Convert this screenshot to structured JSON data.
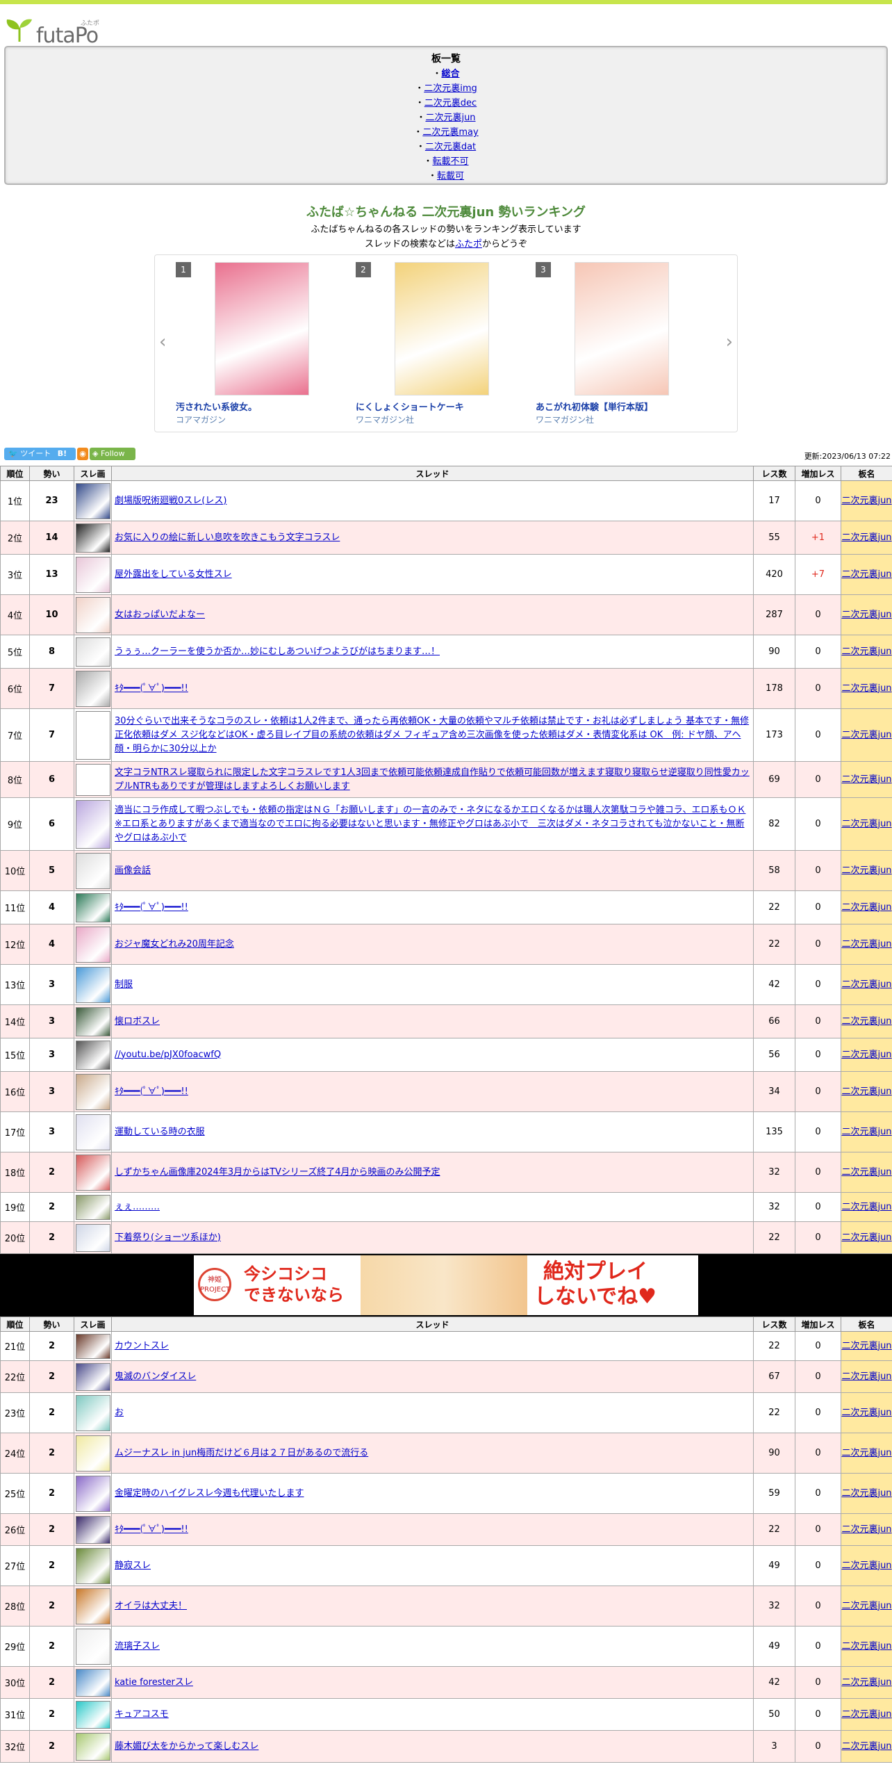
{
  "site": {
    "logo_text": "futaPo",
    "logo_kana": "ふたポ"
  },
  "boards": {
    "title": "板一覧",
    "items": [
      {
        "label": "総合",
        "bold": true
      },
      {
        "label": "二次元裏img"
      },
      {
        "label": "二次元裏dec"
      },
      {
        "label": "二次元裏jun"
      },
      {
        "label": "二次元裏may"
      },
      {
        "label": "二次元裏dat"
      },
      {
        "label": "転載不可"
      },
      {
        "label": "転載可"
      }
    ]
  },
  "heading": {
    "title": "ふたば☆ちゃんねる 二次元裏jun 勢いランキング",
    "desc1": "ふたばちゃんねるの各スレッドの勢いをランキング表示しています",
    "desc2_pre": "スレッドの検索などは",
    "desc2_link": "ふたポ",
    "desc2_post": "からどうぞ"
  },
  "carousel": [
    {
      "num": "1",
      "title": "汚されたい系彼女。",
      "publisher": "コアマガジン",
      "color": "#e9708e"
    },
    {
      "num": "2",
      "title": "にくしょくショートケーキ",
      "publisher": "ワニマガジン社",
      "color": "#f3d27a"
    },
    {
      "num": "3",
      "title": "あこがれ初体験【単行本版】",
      "publisher": "ワニマガジン社",
      "color": "#f6c6b5"
    }
  ],
  "share": {
    "tweet": "ツイート",
    "follow": "Follow",
    "updated": "更新:2023/06/13 07:22"
  },
  "columns": {
    "pos": "順位",
    "momentum": "勢い",
    "thumb": "スレ画",
    "thread": "スレッド",
    "res": "レス数",
    "inc": "増加レス",
    "board": "板名"
  },
  "rows": [
    {
      "pos": "1位",
      "mom": "23",
      "title": "劇場版呪術廻戦0スレ(レス)",
      "res": "17",
      "inc": "0",
      "board": "二次元裏jun",
      "h": 58,
      "tc": "#334a8a"
    },
    {
      "pos": "2位",
      "mom": "14",
      "title": "お気に入りの絵に新しい息吹を吹きこもう文字コラスレ",
      "res": "55",
      "inc": "+1",
      "board": "二次元裏jun",
      "h": 48,
      "tc": "#222222"
    },
    {
      "pos": "3位",
      "mom": "13",
      "title": "屋外露出をしている女性スレ",
      "res": "420",
      "inc": "+7",
      "board": "二次元裏jun",
      "h": 58,
      "tc": "#e8c6d8"
    },
    {
      "pos": "4位",
      "mom": "10",
      "title": "女はおっぱいだよなー",
      "res": "287",
      "inc": "0",
      "board": "二次元裏jun",
      "h": 58,
      "tc": "#f1d2c8"
    },
    {
      "pos": "5位",
      "mom": "8",
      "title": "うぅぅ…クーラーを使うか否か…妙にむしあついげつようびがはちまります…！",
      "res": "90",
      "inc": "0",
      "board": "二次元裏jun",
      "h": 48,
      "tc": "#dddddd"
    },
    {
      "pos": "6位",
      "mom": "7",
      "title": "ｷﾀ━━━(ﾟ∀ﾟ)━━━!!",
      "res": "178",
      "inc": "0",
      "board": "二次元裏jun",
      "h": 58,
      "tc": "#aaaaaa"
    },
    {
      "pos": "7位",
      "mom": "7",
      "title": "30分ぐらいで出来そうなコラのスレ・依頼は1人2件まで、通ったら再依頼OK・大量の依頼やマルチ依頼は禁止です・お礼は必ずしましょう 基本です・無修正化依頼はダメ スジ化などはOK・虚ろ目レイプ目の系統の依頼はダメ フィギュア含め三次画像を使った依頼はダメ・表情変化系は OK　例: ドヤ顔、アヘ顔・明らかに30分以上か",
      "res": "173",
      "inc": "0",
      "board": "二次元裏jun",
      "h": 76,
      "tc": "#ffffff"
    },
    {
      "pos": "8位",
      "mom": "6",
      "title": "文字コラNTRスレ寝取られに限定した文字コラスレです1人3回まで依頼可能依頼達成自作貼りで依頼可能回数が増えます寝取り寝取らせ逆寝取り同性愛カップルNTRもありですが管理はしますよろしくお願いします",
      "res": "69",
      "inc": "0",
      "board": "二次元裏jun",
      "h": 52,
      "tc": "#ffffff"
    },
    {
      "pos": "9位",
      "mom": "6",
      "title": "適当にコラ作成して暇つぶしでも・依頼の指定はＮＧ「お願いします」の一言のみで・ネタになるかエロくなるかは職人次第駄コラや雑コラ、エロ系もＯＫ※エロ系とありますがあくまで適当なのでエロに拘る必要はないと思います・無修正やグロはあぶ小で　三次はダメ・ネタコラされても泣かないこと・無断やグロはあぶ小で",
      "res": "82",
      "inc": "0",
      "board": "二次元裏jun",
      "h": 76,
      "tc": "#b9a6de"
    },
    {
      "pos": "10位",
      "mom": "5",
      "title": "画像会話",
      "res": "58",
      "inc": "0",
      "board": "二次元裏jun",
      "h": 58,
      "tc": "#dddddd"
    },
    {
      "pos": "11位",
      "mom": "4",
      "title": "ｷﾀ━━━(ﾟ∀ﾟ)━━━!!",
      "res": "22",
      "inc": "0",
      "board": "二次元裏jun",
      "h": 48,
      "tc": "#2c7a58"
    },
    {
      "pos": "12位",
      "mom": "4",
      "title": "おジャ魔女どれみ20周年記念",
      "res": "22",
      "inc": "0",
      "board": "二次元裏jun",
      "h": 58,
      "tc": "#e9a8c6"
    },
    {
      "pos": "13位",
      "mom": "3",
      "title": "制服",
      "res": "42",
      "inc": "0",
      "board": "二次元裏jun",
      "h": 58,
      "tc": "#4a9ad8"
    },
    {
      "pos": "14位",
      "mom": "3",
      "title": "懐ロボスレ",
      "res": "66",
      "inc": "0",
      "board": "二次元裏jun",
      "h": 48,
      "tc": "#3a5a3a"
    },
    {
      "pos": "15位",
      "mom": "3",
      "title": "//youtu.be/pJX0foacwfQ",
      "res": "56",
      "inc": "0",
      "board": "二次元裏jun",
      "h": 48,
      "tc": "#555555"
    },
    {
      "pos": "16位",
      "mom": "3",
      "title": "ｷﾀ━━━(ﾟ∀ﾟ)━━━!!",
      "res": "34",
      "inc": "0",
      "board": "二次元裏jun",
      "h": 58,
      "tc": "#c9a98a"
    },
    {
      "pos": "17位",
      "mom": "3",
      "title": "運動している時の衣服",
      "res": "135",
      "inc": "0",
      "board": "二次元裏jun",
      "h": 58,
      "tc": "#e0e0f0"
    },
    {
      "pos": "18位",
      "mom": "2",
      "title": "しずかちゃん画像庫2024年3月からはTVシリーズ終了4月から映画のみ公開予定",
      "res": "32",
      "inc": "0",
      "board": "二次元裏jun",
      "h": 58,
      "tc": "#d65a5a"
    },
    {
      "pos": "19位",
      "mom": "2",
      "title": "ぇぇ………",
      "res": "32",
      "inc": "0",
      "board": "二次元裏jun",
      "h": 42,
      "tc": "#8a9a6a"
    },
    {
      "pos": "20位",
      "mom": "2",
      "title": "下着祭り(ショーツ系ほか)",
      "res": "22",
      "inc": "0",
      "board": "二次元裏jun",
      "h": 46,
      "tc": "#cfd6e6"
    }
  ],
  "ad": {
    "left": "今シコシコ\nできないなら",
    "right": "絶対プレイ\nしないでね♥",
    "badge": "神姫 PROJECT"
  },
  "rows2": [
    {
      "pos": "21位",
      "mom": "2",
      "title": "カウントスレ",
      "res": "22",
      "inc": "0",
      "board": "二次元裏jun",
      "h": 42,
      "tc": "#6a3a2a"
    },
    {
      "pos": "22位",
      "mom": "2",
      "title": "鬼滅のバンダイスレ",
      "res": "67",
      "inc": "0",
      "board": "二次元裏jun",
      "h": 46,
      "tc": "#4a4a8a"
    },
    {
      "pos": "23位",
      "mom": "2",
      "title": "お",
      "res": "22",
      "inc": "0",
      "board": "二次元裏jun",
      "h": 58,
      "tc": "#7ec8c0"
    },
    {
      "pos": "24位",
      "mom": "2",
      "title": "ムジーナスレ in jun梅雨だけど６月は２７日があるので流行る",
      "res": "90",
      "inc": "0",
      "board": "二次元裏jun",
      "h": 58,
      "tc": "#f0e9a0"
    },
    {
      "pos": "25位",
      "mom": "2",
      "title": "金曜定時のハイグレスレ今週も代理いたします",
      "res": "59",
      "inc": "0",
      "board": "二次元裏jun",
      "h": 58,
      "tc": "#8a6ac8"
    },
    {
      "pos": "26位",
      "mom": "2",
      "title": "ｷﾀ━━━(ﾟ∀ﾟ)━━━!!",
      "res": "22",
      "inc": "0",
      "board": "二次元裏jun",
      "h": 46,
      "tc": "#3a2a6a"
    },
    {
      "pos": "27位",
      "mom": "2",
      "title": "静寂スレ",
      "res": "49",
      "inc": "0",
      "board": "二次元裏jun",
      "h": 58,
      "tc": "#6a8a3a"
    },
    {
      "pos": "28位",
      "mom": "2",
      "title": "オイラは大丈夫！",
      "res": "32",
      "inc": "0",
      "board": "二次元裏jun",
      "h": 58,
      "tc": "#c8782a"
    },
    {
      "pos": "29位",
      "mom": "2",
      "title": "流璃子スレ",
      "res": "49",
      "inc": "0",
      "board": "二次元裏jun",
      "h": 58,
      "tc": "#eeeeee"
    },
    {
      "pos": "30位",
      "mom": "2",
      "title": "katie foresterスレ",
      "res": "42",
      "inc": "0",
      "board": "二次元裏jun",
      "h": 46,
      "tc": "#4a8ac8"
    },
    {
      "pos": "31位",
      "mom": "2",
      "title": "キュアコスモ",
      "res": "50",
      "inc": "0",
      "board": "二次元裏jun",
      "h": 46,
      "tc": "#2ac8c8"
    },
    {
      "pos": "32位",
      "mom": "2",
      "title": "藤木媚び太をからかって楽しむスレ",
      "res": "3",
      "inc": "0",
      "board": "二次元裏jun",
      "h": 46,
      "tc": "#a8c870"
    }
  ]
}
